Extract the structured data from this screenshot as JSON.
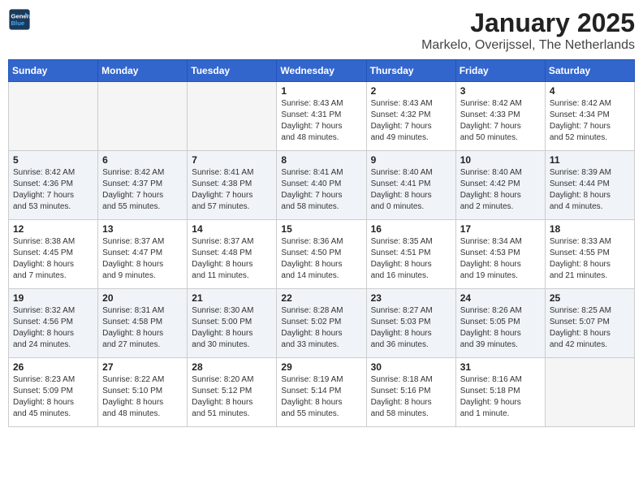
{
  "header": {
    "logo_line1": "General",
    "logo_line2": "Blue",
    "title": "January 2025",
    "subtitle": "Markelo, Overijssel, The Netherlands"
  },
  "weekdays": [
    "Sunday",
    "Monday",
    "Tuesday",
    "Wednesday",
    "Thursday",
    "Friday",
    "Saturday"
  ],
  "weeks": [
    [
      {
        "day": "",
        "info": ""
      },
      {
        "day": "",
        "info": ""
      },
      {
        "day": "",
        "info": ""
      },
      {
        "day": "1",
        "info": "Sunrise: 8:43 AM\nSunset: 4:31 PM\nDaylight: 7 hours\nand 48 minutes."
      },
      {
        "day": "2",
        "info": "Sunrise: 8:43 AM\nSunset: 4:32 PM\nDaylight: 7 hours\nand 49 minutes."
      },
      {
        "day": "3",
        "info": "Sunrise: 8:42 AM\nSunset: 4:33 PM\nDaylight: 7 hours\nand 50 minutes."
      },
      {
        "day": "4",
        "info": "Sunrise: 8:42 AM\nSunset: 4:34 PM\nDaylight: 7 hours\nand 52 minutes."
      }
    ],
    [
      {
        "day": "5",
        "info": "Sunrise: 8:42 AM\nSunset: 4:36 PM\nDaylight: 7 hours\nand 53 minutes."
      },
      {
        "day": "6",
        "info": "Sunrise: 8:42 AM\nSunset: 4:37 PM\nDaylight: 7 hours\nand 55 minutes."
      },
      {
        "day": "7",
        "info": "Sunrise: 8:41 AM\nSunset: 4:38 PM\nDaylight: 7 hours\nand 57 minutes."
      },
      {
        "day": "8",
        "info": "Sunrise: 8:41 AM\nSunset: 4:40 PM\nDaylight: 7 hours\nand 58 minutes."
      },
      {
        "day": "9",
        "info": "Sunrise: 8:40 AM\nSunset: 4:41 PM\nDaylight: 8 hours\nand 0 minutes."
      },
      {
        "day": "10",
        "info": "Sunrise: 8:40 AM\nSunset: 4:42 PM\nDaylight: 8 hours\nand 2 minutes."
      },
      {
        "day": "11",
        "info": "Sunrise: 8:39 AM\nSunset: 4:44 PM\nDaylight: 8 hours\nand 4 minutes."
      }
    ],
    [
      {
        "day": "12",
        "info": "Sunrise: 8:38 AM\nSunset: 4:45 PM\nDaylight: 8 hours\nand 7 minutes."
      },
      {
        "day": "13",
        "info": "Sunrise: 8:37 AM\nSunset: 4:47 PM\nDaylight: 8 hours\nand 9 minutes."
      },
      {
        "day": "14",
        "info": "Sunrise: 8:37 AM\nSunset: 4:48 PM\nDaylight: 8 hours\nand 11 minutes."
      },
      {
        "day": "15",
        "info": "Sunrise: 8:36 AM\nSunset: 4:50 PM\nDaylight: 8 hours\nand 14 minutes."
      },
      {
        "day": "16",
        "info": "Sunrise: 8:35 AM\nSunset: 4:51 PM\nDaylight: 8 hours\nand 16 minutes."
      },
      {
        "day": "17",
        "info": "Sunrise: 8:34 AM\nSunset: 4:53 PM\nDaylight: 8 hours\nand 19 minutes."
      },
      {
        "day": "18",
        "info": "Sunrise: 8:33 AM\nSunset: 4:55 PM\nDaylight: 8 hours\nand 21 minutes."
      }
    ],
    [
      {
        "day": "19",
        "info": "Sunrise: 8:32 AM\nSunset: 4:56 PM\nDaylight: 8 hours\nand 24 minutes."
      },
      {
        "day": "20",
        "info": "Sunrise: 8:31 AM\nSunset: 4:58 PM\nDaylight: 8 hours\nand 27 minutes."
      },
      {
        "day": "21",
        "info": "Sunrise: 8:30 AM\nSunset: 5:00 PM\nDaylight: 8 hours\nand 30 minutes."
      },
      {
        "day": "22",
        "info": "Sunrise: 8:28 AM\nSunset: 5:02 PM\nDaylight: 8 hours\nand 33 minutes."
      },
      {
        "day": "23",
        "info": "Sunrise: 8:27 AM\nSunset: 5:03 PM\nDaylight: 8 hours\nand 36 minutes."
      },
      {
        "day": "24",
        "info": "Sunrise: 8:26 AM\nSunset: 5:05 PM\nDaylight: 8 hours\nand 39 minutes."
      },
      {
        "day": "25",
        "info": "Sunrise: 8:25 AM\nSunset: 5:07 PM\nDaylight: 8 hours\nand 42 minutes."
      }
    ],
    [
      {
        "day": "26",
        "info": "Sunrise: 8:23 AM\nSunset: 5:09 PM\nDaylight: 8 hours\nand 45 minutes."
      },
      {
        "day": "27",
        "info": "Sunrise: 8:22 AM\nSunset: 5:10 PM\nDaylight: 8 hours\nand 48 minutes."
      },
      {
        "day": "28",
        "info": "Sunrise: 8:20 AM\nSunset: 5:12 PM\nDaylight: 8 hours\nand 51 minutes."
      },
      {
        "day": "29",
        "info": "Sunrise: 8:19 AM\nSunset: 5:14 PM\nDaylight: 8 hours\nand 55 minutes."
      },
      {
        "day": "30",
        "info": "Sunrise: 8:18 AM\nSunset: 5:16 PM\nDaylight: 8 hours\nand 58 minutes."
      },
      {
        "day": "31",
        "info": "Sunrise: 8:16 AM\nSunset: 5:18 PM\nDaylight: 9 hours\nand 1 minute."
      },
      {
        "day": "",
        "info": ""
      }
    ]
  ]
}
